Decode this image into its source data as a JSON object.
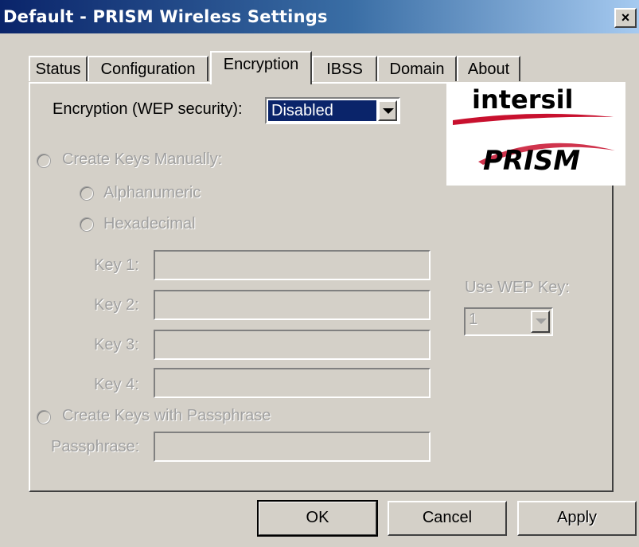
{
  "window": {
    "title": "Default - PRISM Wireless Settings",
    "close_label": "×"
  },
  "tabs": [
    {
      "label": "Status"
    },
    {
      "label": "Configuration"
    },
    {
      "label": "Encryption",
      "active": true
    },
    {
      "label": "IBSS"
    },
    {
      "label": "Domain"
    },
    {
      "label": "About"
    }
  ],
  "encryption": {
    "label": "Encryption (WEP security):",
    "value": "Disabled"
  },
  "manual": {
    "label": "Create Keys Manually:",
    "alphanumeric": "Alphanumeric",
    "hexadecimal": "Hexadecimal"
  },
  "keys": [
    {
      "label": "Key 1:"
    },
    {
      "label": "Key 2:"
    },
    {
      "label": "Key 3:"
    },
    {
      "label": "Key 4:"
    }
  ],
  "use_wep_key": {
    "label": "Use WEP Key:",
    "value": "1"
  },
  "passphrase": {
    "radio_label": "Create Keys with Passphrase",
    "label": "Passphrase:"
  },
  "logo": {
    "brand_top": "intersil",
    "brand_bottom": "PRISM"
  },
  "buttons": {
    "ok": "OK",
    "cancel": "Cancel",
    "apply": "Apply"
  },
  "colors": {
    "titlebar": "#0a246a",
    "face": "#d4d0c8",
    "logo_red": "#c8102e"
  }
}
